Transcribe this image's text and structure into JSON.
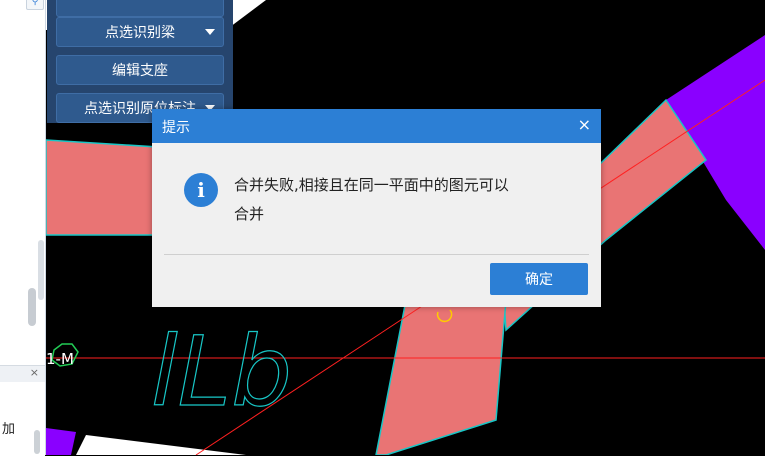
{
  "left_panel": {
    "bottom_text": "加",
    "close_label": "×"
  },
  "canvas": {
    "axis_label": "1-M",
    "drawn_text": "lLb"
  },
  "toolbar": {
    "items": [
      {
        "label": "点选识别梁"
      },
      {
        "label": "编辑支座"
      },
      {
        "label": "点选识别原位标注"
      }
    ]
  },
  "dialog": {
    "title": "提示",
    "close_label": "×",
    "icon": "info-icon",
    "message_line1": "合并失败,相接且在同一平面中的图元可以",
    "message_line2": "合并",
    "ok_label": "确定"
  },
  "colors": {
    "beam_fill": "#e97474",
    "beam_edge": "#18c6c6",
    "purple": "#8a00ff",
    "axis_red": "#ff2020",
    "accent": "#2c7fd5"
  }
}
